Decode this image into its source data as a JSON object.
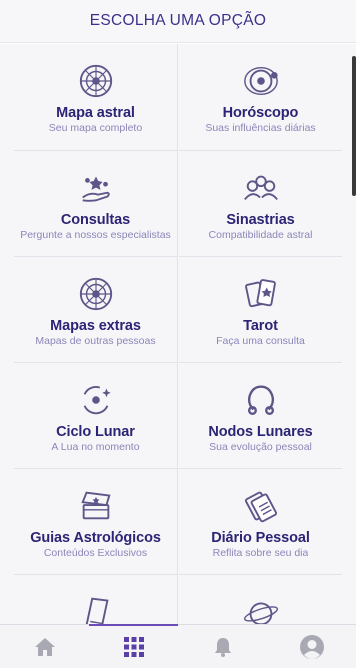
{
  "header": {
    "title": "ESCOLHA UMA OPÇÃO"
  },
  "options": [
    {
      "title": "Mapa astral",
      "subtitle": "Seu mapa completo",
      "icon": "zodiac-wheel-icon"
    },
    {
      "title": "Horóscopo",
      "subtitle": "Suas influências diárias",
      "icon": "planet-orbit-icon"
    },
    {
      "title": "Consultas",
      "subtitle": "Pergunte a nossos especialistas",
      "icon": "hand-stars-icon"
    },
    {
      "title": "Sinastrias",
      "subtitle": "Compatibilidade astral",
      "icon": "people-group-icon"
    },
    {
      "title": "Mapas extras",
      "subtitle": "Mapas de outras pessoas",
      "icon": "zodiac-wheel-icon"
    },
    {
      "title": "Tarot",
      "subtitle": "Faça uma consulta",
      "icon": "tarot-cards-icon"
    },
    {
      "title": "Ciclo Lunar",
      "subtitle": "A Lua no momento",
      "icon": "moon-cycle-icon"
    },
    {
      "title": "Nodos Lunares",
      "subtitle": "Sua evolução pessoal",
      "icon": "lunar-nodes-icon"
    },
    {
      "title": "Guias Astrológicos",
      "subtitle": "Conteúdos Exclusivos",
      "icon": "treasure-chest-icon"
    },
    {
      "title": "Diário Pessoal",
      "subtitle": "Reflita sobre seu dia",
      "icon": "journal-icon"
    }
  ],
  "bottom_nav": [
    {
      "name": "home",
      "icon": "home-icon"
    },
    {
      "name": "menu",
      "icon": "grid-icon",
      "active": true
    },
    {
      "name": "notifications",
      "icon": "bell-icon"
    },
    {
      "name": "profile",
      "icon": "avatar-icon"
    }
  ],
  "colors": {
    "primary": "#2c2474",
    "subtitle": "#8b86b8",
    "accent": "#6a4bb8",
    "icon": "#5e5688"
  }
}
